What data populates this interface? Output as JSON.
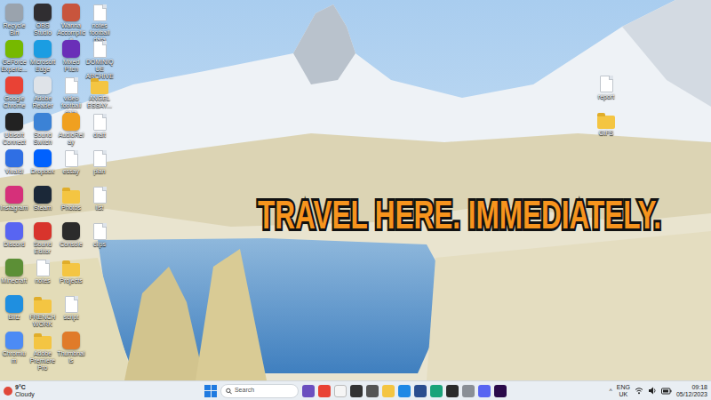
{
  "desktop": {
    "icons": [
      {
        "label": "Recycle Bin",
        "kind": "app",
        "color": "#9aa3ad"
      },
      {
        "label": "GeForce Experie...",
        "kind": "app",
        "color": "#76b900"
      },
      {
        "label": "Google Chrome",
        "kind": "app",
        "color": "#e94235"
      },
      {
        "label": "Ubisoft Connect",
        "kind": "app",
        "color": "#222222"
      },
      {
        "label": "Vivaldi",
        "kind": "app",
        "color": "#2f6fe4"
      },
      {
        "label": "Instagram",
        "kind": "app",
        "color": "#d6307a"
      },
      {
        "label": "Discord",
        "kind": "app",
        "color": "#5865f2"
      },
      {
        "label": "Minecraft",
        "kind": "app",
        "color": "#5c8f36"
      },
      {
        "label": "Blitz",
        "kind": "app",
        "color": "#1f8fe0"
      },
      {
        "label": "Chromium",
        "kind": "app",
        "color": "#4c8bf5"
      },
      {
        "label": "OBS Studio",
        "kind": "app",
        "color": "#302e31"
      },
      {
        "label": "Microsoft Edge",
        "kind": "app",
        "color": "#1b9de2"
      },
      {
        "label": "Adobe Reader",
        "kind": "app",
        "color": "#dfe3e8"
      },
      {
        "label": "Sound Switch",
        "kind": "app",
        "color": "#3b82d6"
      },
      {
        "label": "Dropbox",
        "kind": "app",
        "color": "#0061fe"
      },
      {
        "label": "Steam",
        "kind": "app",
        "color": "#1b2838"
      },
      {
        "label": "Sound Editor",
        "kind": "app",
        "color": "#d8342c"
      },
      {
        "label": "notes",
        "kind": "file"
      },
      {
        "label": "FRENCH WORK",
        "kind": "folder"
      },
      {
        "label": "Adobe Premiere Pro",
        "kind": "folder"
      },
      {
        "label": "Wanna Accomplice",
        "kind": "app",
        "color": "#c8553d"
      },
      {
        "label": "Mixed Pitch",
        "kind": "app",
        "color": "#6a2fb8"
      },
      {
        "label": "video football data",
        "kind": "file"
      },
      {
        "label": "AudioRelay",
        "kind": "app",
        "color": "#f0a020"
      },
      {
        "label": "essay",
        "kind": "file"
      },
      {
        "label": "Photos",
        "kind": "folder"
      },
      {
        "label": "Console",
        "kind": "app",
        "color": "#2b2b2b"
      },
      {
        "label": "Projects",
        "kind": "folder"
      },
      {
        "label": "script",
        "kind": "file"
      },
      {
        "label": "Thumbnails",
        "kind": "app",
        "color": "#e07b2a"
      },
      {
        "label": "notes football data",
        "kind": "file"
      },
      {
        "label": "DOMINIQUE ARCHIVE...",
        "kind": "file"
      },
      {
        "label": "ANGEL ESSAY...",
        "kind": "folder"
      },
      {
        "label": "draft",
        "kind": "file"
      },
      {
        "label": "plan",
        "kind": "file"
      },
      {
        "label": "list",
        "kind": "file"
      },
      {
        "label": "clips",
        "kind": "file"
      }
    ],
    "right_icons": [
      {
        "label": "report",
        "kind": "file"
      },
      {
        "label": "GIFS",
        "kind": "folder"
      }
    ]
  },
  "overlay_caption": "TRAVEL HERE. IMMEDIATELY.",
  "taskbar": {
    "weather": {
      "temp": "9°C",
      "condition": "Cloudy"
    },
    "search": {
      "placeholder": "Search"
    },
    "pinned": [
      {
        "color": "#6b4fbf"
      },
      {
        "color": "#e94235"
      },
      {
        "color": "#f5f5f5"
      },
      {
        "color": "#333333"
      },
      {
        "color": "#555555"
      },
      {
        "color": "#f4c542"
      },
      {
        "color": "#1e88e5"
      },
      {
        "color": "#2a4d8f"
      },
      {
        "color": "#1aa37a"
      },
      {
        "color": "#2b2b2b"
      },
      {
        "color": "#8a8f96"
      },
      {
        "color": "#5865f2"
      },
      {
        "color": "#2a0a4a"
      }
    ],
    "tray": {
      "chevron": "^",
      "language": "ENG",
      "region": "UK",
      "time": "09:18",
      "date": "05/12/2023"
    }
  }
}
